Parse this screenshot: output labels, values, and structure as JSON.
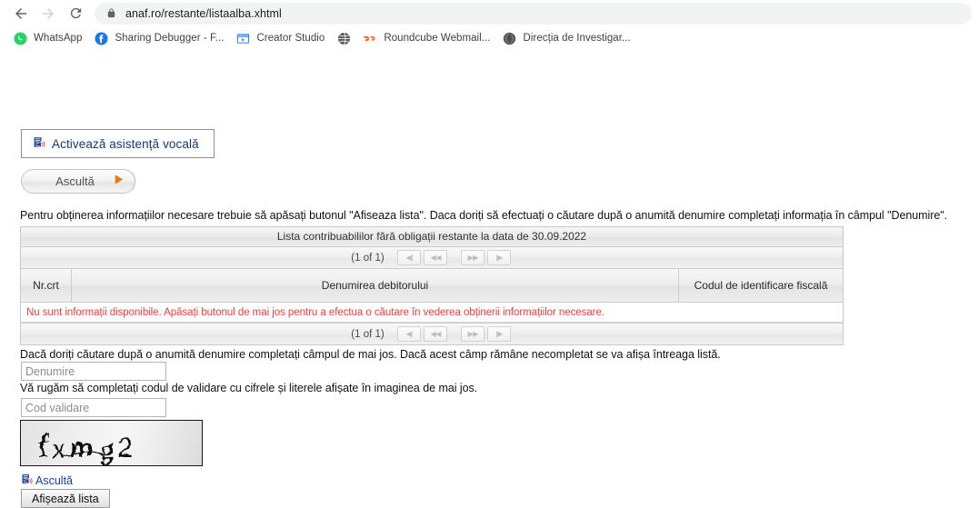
{
  "browser": {
    "nav": {
      "back_icon": "arrow-left-icon",
      "forward_icon": "arrow-right-icon",
      "reload_icon": "reload-icon"
    },
    "omnibox": {
      "lock_icon": "lock-icon",
      "url": "anaf.ro/restante/listaalba.xhtml"
    },
    "bookmarks": [
      {
        "label": "WhatsApp",
        "icon": "whatsapp-icon"
      },
      {
        "label": "Sharing Debugger - F...",
        "icon": "facebook-icon"
      },
      {
        "label": "Creator Studio",
        "icon": "creator-studio-icon"
      },
      {
        "label": "",
        "icon": "globe-icon"
      },
      {
        "label": "Roundcube Webmail...",
        "icon": "cpanel-icon"
      },
      {
        "label": "Direcția de Investigar...",
        "icon": "diicot-icon"
      }
    ]
  },
  "page": {
    "readspeaker": {
      "activate_label": "Activează asistență vocală",
      "activate_icon": "document-speaker-icon",
      "player_label": "Ascultă",
      "play_icon": "play-triangle-icon"
    },
    "intro_text": "Pentru obținerea informațiilor necesare trebuie să apăsați butonul \"Afiseaza lista\". Daca doriți să efectuați o căutare după o anumită denumire completați informația în câmpul \"Denumire\".",
    "table": {
      "title": "Lista contribuabililor fără obligații restante la data de 30.09.2022",
      "pager": {
        "count": "(1 of 1)",
        "first_icon": "first-page-icon",
        "prev_icon": "prev-page-icon",
        "next_icon": "next-page-icon",
        "last_icon": "last-page-icon",
        "first_label": "◀|",
        "prev_label": "◀◀",
        "next_label": "▶▶",
        "last_label": "|▶"
      },
      "columns": [
        "Nr.crt",
        "Denumirea debitorului",
        "Codul de identificare fiscală"
      ],
      "empty_message": "Nu sunt informații disponibile. Apăsați butonul de mai jos pentru a efectua o căutare în vederea obținerii informațiilor necesare.",
      "rows": []
    },
    "search_hint": "Dacă doriți căutare după o anumită denumire completați câmpul de mai jos. Dacă acest câmp rămâne necompletat se va afișa întreaga listă.",
    "denumire_field": {
      "value": "",
      "placeholder": "Denumire"
    },
    "captcha_hint": "Vă rugăm să completați codul de validare cu cifrele și literele afișate în imaginea de mai jos.",
    "cod_field": {
      "value": "",
      "placeholder": "Cod validare"
    },
    "captcha": {
      "text": "fxmg2",
      "icon": "captcha-image"
    },
    "listen_link": {
      "label": "Ascultă",
      "icon": "document-speaker-icon"
    },
    "submit_button": "Afișează lista"
  },
  "colors": {
    "link_blue": "#17419c",
    "error_red": "#e8413b",
    "accent_orange": "#e8790c",
    "chrome_gray": "#f1f3f4"
  }
}
